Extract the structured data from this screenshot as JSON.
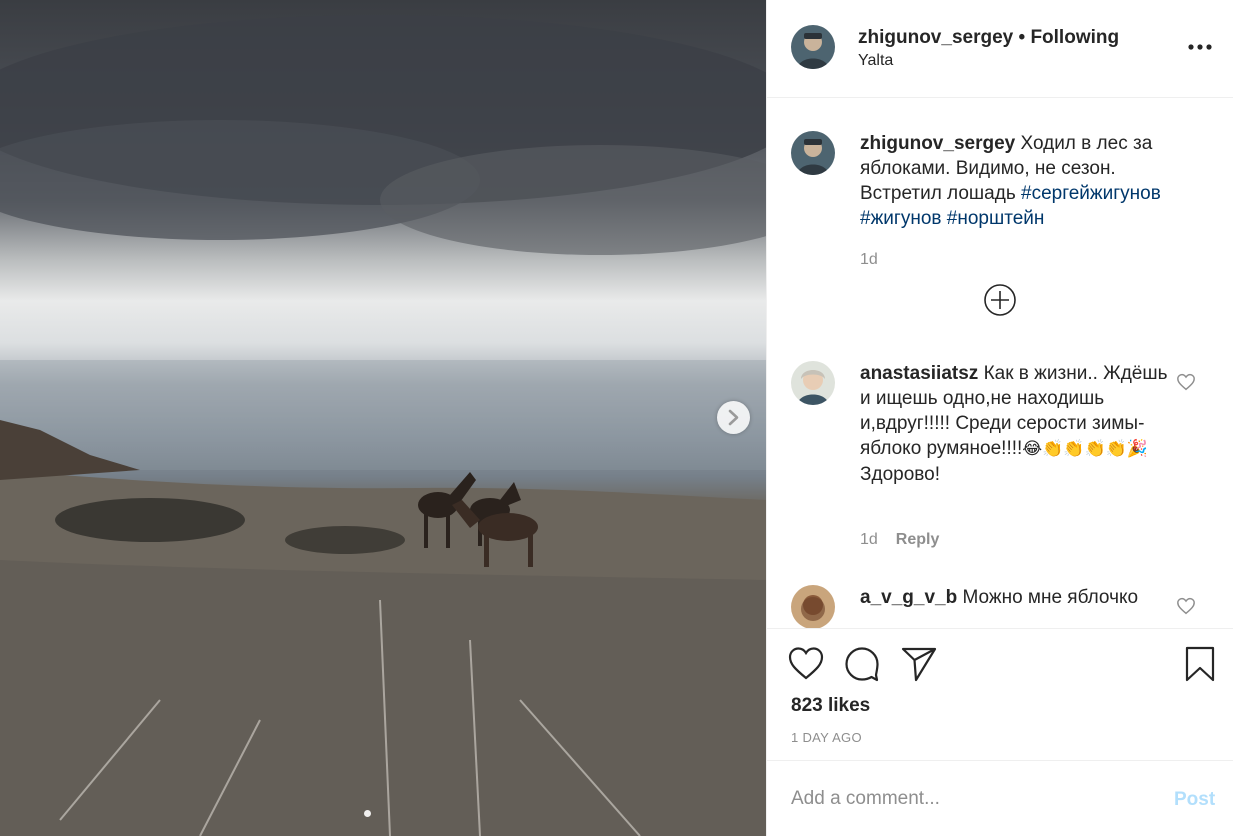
{
  "post": {
    "image_alt": "Horses on a hilltop above the sea under a cloudy sky",
    "carousel_next_icon": "chevron-right-icon"
  },
  "header": {
    "username": "zhigunov_sergey",
    "separator": "•",
    "follow_status": "Following",
    "location": "Yalta",
    "more_icon": "more-horizontal-icon"
  },
  "caption": {
    "username": "zhigunov_sergey",
    "text": "Ходил в лес за яблоками. Видимо, не сезон. Встретил лошадь",
    "hashtags": [
      "#сергейжигунов",
      "#жигунов",
      "#норштейн"
    ],
    "time": "1d"
  },
  "comments": [
    {
      "username": "anastasiiatsz",
      "text": "Как в жизни.. Ждёшь и ищешь одно,не находишь и,вдруг!!!!! Среди серости зимы- яблоко румяное!!!!",
      "emojis": "😂👏👏👏👏🎉",
      "text_after": "Здорово!",
      "time": "1d",
      "reply_label": "Reply"
    },
    {
      "username": "a_v_g_v_b",
      "text": "Можно мне яблочко",
      "time": "",
      "reply_label": ""
    }
  ],
  "actions": {
    "like_icon": "heart-icon",
    "comment_icon": "comment-icon",
    "share_icon": "share-icon",
    "save_icon": "bookmark-icon",
    "load_more_icon": "plus-circle-icon"
  },
  "stats": {
    "likes": "823 likes",
    "date": "1 DAY AGO"
  },
  "comment_box": {
    "placeholder": "Add a comment...",
    "post_label": "Post"
  }
}
